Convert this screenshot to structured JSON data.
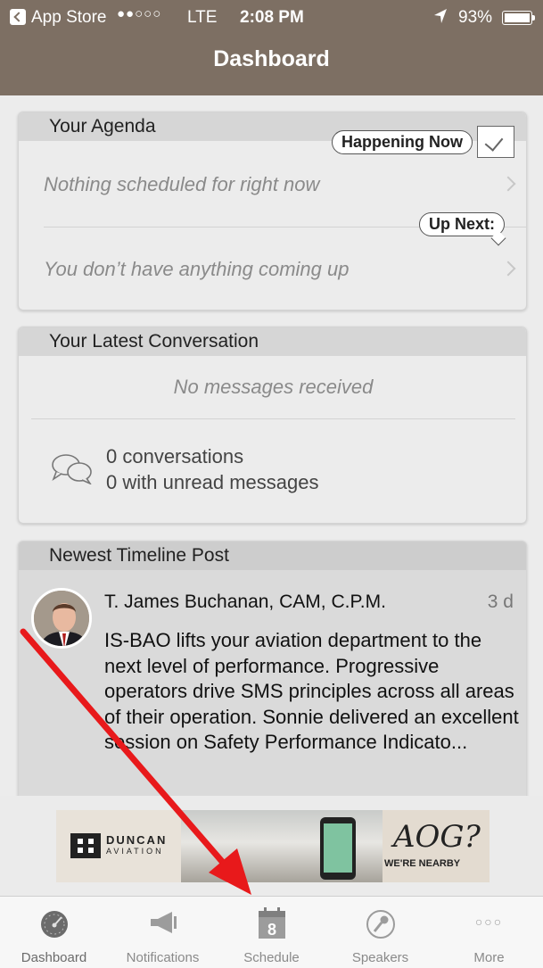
{
  "status_bar": {
    "back_app": "App Store",
    "signal": "●●○○○",
    "carrier": "LTE",
    "time": "2:08 PM",
    "battery": "93%"
  },
  "nav": {
    "title": "Dashboard"
  },
  "agenda": {
    "header": "Your Agenda",
    "happening_badge": "Happening Now",
    "happening_text": "Nothing scheduled for right now",
    "next_badge": "Up Next:",
    "next_text": "You don’t have anything coming up"
  },
  "conversation": {
    "header": "Your Latest Conversation",
    "empty_text": "No messages received",
    "count_line": "0 conversations",
    "unread_line": "0 with unread messages"
  },
  "timeline": {
    "header": "Newest Timeline Post",
    "author": "T. James Buchanan, CAM, C.P.M.",
    "age": "3 d",
    "body": "IS-BAO lifts your aviation department to the next level of performance. Progressive operators drive SMS principles across all areas of their operation.  Sonnie delivered an excellent session on Safety Performance Indicato..."
  },
  "ad": {
    "brand": "DUNCAN",
    "brand_sub": "AVIATION",
    "headline": "AOG?",
    "tagline": "WE'RE NEARBY"
  },
  "tabbar": {
    "items": [
      {
        "label": "Dashboard",
        "icon": "dashboard-gauge-icon"
      },
      {
        "label": "Notifications",
        "icon": "megaphone-icon"
      },
      {
        "label": "Schedule",
        "icon": "calendar-icon",
        "icon_text": "8"
      },
      {
        "label": "Speakers",
        "icon": "microphone-icon"
      },
      {
        "label": "More",
        "icon": "more-dots-icon",
        "icon_text": "○○○"
      }
    ]
  },
  "colors": {
    "navbar": "#7d6f63",
    "card_header": "#d6d6d6",
    "annotation_arrow": "#e8191b"
  }
}
